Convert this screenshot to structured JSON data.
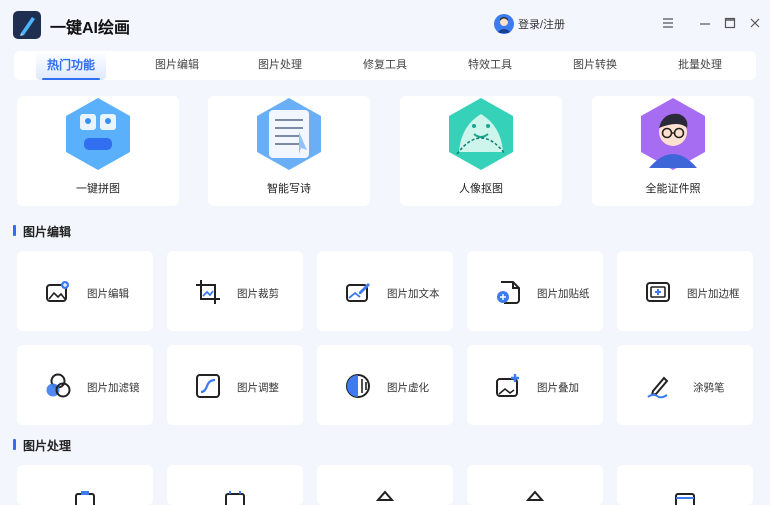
{
  "app": {
    "title": "一键AI绘画"
  },
  "header": {
    "login_label": "登录/注册"
  },
  "tabs": [
    "热门功能",
    "图片编辑",
    "图片处理",
    "修复工具",
    "特效工具",
    "图片转换",
    "批量处理"
  ],
  "hot_features": [
    {
      "label": "一键拼图",
      "icon": "collage-icon"
    },
    {
      "label": "智能写诗",
      "icon": "poem-icon"
    },
    {
      "label": "人像抠图",
      "icon": "portrait-cutout-icon"
    },
    {
      "label": "全能证件照",
      "icon": "id-photo-icon"
    }
  ],
  "sections": {
    "edit": {
      "title": "图片编辑"
    },
    "process": {
      "title": "图片处理"
    }
  },
  "edit_tools": [
    {
      "label": "图片编辑",
      "icon": "image-edit-icon"
    },
    {
      "label": "图片裁剪",
      "icon": "crop-icon"
    },
    {
      "label": "图片加文本",
      "icon": "add-text-icon"
    },
    {
      "label": "图片加贴纸",
      "icon": "sticker-icon"
    },
    {
      "label": "图片加边框",
      "icon": "border-icon"
    },
    {
      "label": "图片加滤镜",
      "icon": "filter-icon"
    },
    {
      "label": "图片调整",
      "icon": "adjust-icon"
    },
    {
      "label": "图片虚化",
      "icon": "blur-icon"
    },
    {
      "label": "图片叠加",
      "icon": "overlay-icon"
    },
    {
      "label": "涂鸦笔",
      "icon": "doodle-pen-icon"
    }
  ],
  "colors": {
    "accent": "#2f6ff0",
    "background": "#f3f6fd",
    "card": "#ffffff"
  }
}
